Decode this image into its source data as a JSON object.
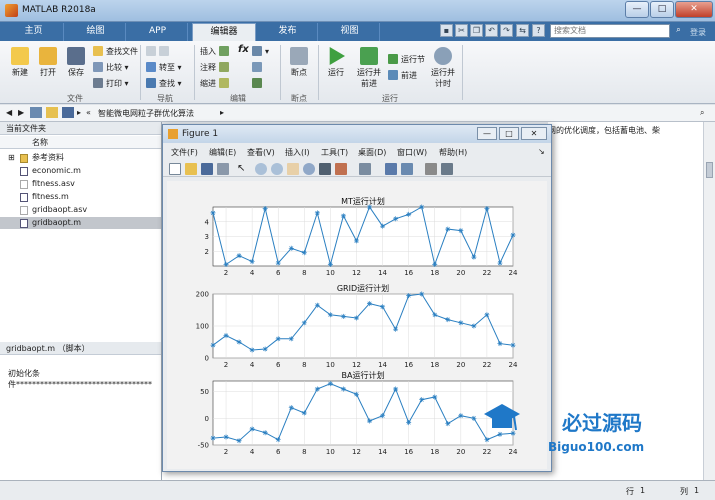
{
  "window": {
    "title": "MATLAB R2018a"
  },
  "tabs": [
    "主页",
    "绘图",
    "APP",
    "编辑器",
    "发布",
    "视图"
  ],
  "search": {
    "placeholder": "搜索文档"
  },
  "login": "登录",
  "toolstrip": {
    "file": {
      "new": "新建",
      "open": "打开",
      "save": "保存",
      "find_files": "查找文件",
      "compare": "比较",
      "print": "打印",
      "label": "文件"
    },
    "nav": {
      "goto": "转至",
      "find": "查找",
      "label": "导航"
    },
    "edit": {
      "insert": "插入",
      "comment": "注释",
      "indent": "缩进",
      "fx": "fx",
      "label": "编辑"
    },
    "breakpoint": {
      "btn": "断点",
      "label": "断点"
    },
    "run": {
      "run": "运行",
      "run_advance": "运行并\n前进",
      "run_section": "运行节",
      "advance": "前进",
      "run_time": "运行并\n计时",
      "label": "运行"
    }
  },
  "path": {
    "crumb": "智能微电网粒子群优化算法"
  },
  "current_folder": {
    "title": "当前文件夹",
    "col_name": "名称",
    "items": [
      {
        "name": "参考资料",
        "type": "folder"
      },
      {
        "name": "economic.m",
        "type": "file"
      },
      {
        "name": "fitness.asv",
        "type": "file"
      },
      {
        "name": "fitness.m",
        "type": "file"
      },
      {
        "name": "gridbaopt.asv",
        "type": "file"
      },
      {
        "name": "gridbaopt.m",
        "type": "file",
        "selected": true
      }
    ]
  },
  "detail": {
    "title": "gridbaopt.m （脚本）",
    "line1": "初始化条",
    "line2": "件**********************************"
  },
  "right_panel": {
    "text": "网的优化调度，包括蓄电池、柴"
  },
  "status": {
    "row_label": "行",
    "row": "1",
    "col_label": "列",
    "col": "1"
  },
  "figure": {
    "title": "Figure 1",
    "menu": [
      "文件(F)",
      "编辑(E)",
      "查看(V)",
      "插入(I)",
      "工具(T)",
      "桌面(D)",
      "窗口(W)",
      "帮助(H)"
    ]
  },
  "watermark": {
    "main": "必过源码",
    "sub": "Biguo100.com"
  },
  "chart_data": [
    {
      "type": "line",
      "title": "MT运行计划",
      "x": [
        1,
        2,
        3,
        4,
        5,
        6,
        7,
        8,
        9,
        10,
        11,
        12,
        13,
        14,
        15,
        16,
        17,
        18,
        19,
        20,
        21,
        22,
        23,
        24
      ],
      "values": [
        4.6,
        1.1,
        1.7,
        1.3,
        4.9,
        1.2,
        2.2,
        1.9,
        4.6,
        1.1,
        4.4,
        2.7,
        5.0,
        3.7,
        4.2,
        4.5,
        5.0,
        1.1,
        3.5,
        3.4,
        1.6,
        4.9,
        1.2,
        3.1
      ],
      "xlim": [
        1,
        24
      ],
      "ylim": [
        1,
        5
      ],
      "yticks": [
        2,
        3,
        4
      ],
      "xticks": [
        2,
        4,
        6,
        8,
        10,
        12,
        14,
        16,
        18,
        20,
        22,
        24
      ],
      "grid": true
    },
    {
      "type": "line",
      "title": "GRID运行计划",
      "x": [
        1,
        2,
        3,
        4,
        5,
        6,
        7,
        8,
        9,
        10,
        11,
        12,
        13,
        14,
        15,
        16,
        17,
        18,
        19,
        20,
        21,
        22,
        23,
        24
      ],
      "values": [
        40,
        70,
        50,
        25,
        28,
        60,
        60,
        110,
        165,
        135,
        130,
        125,
        170,
        160,
        90,
        195,
        200,
        135,
        120,
        110,
        100,
        135,
        45,
        40
      ],
      "xlim": [
        1,
        24
      ],
      "ylim": [
        0,
        200
      ],
      "yticks": [
        0,
        100,
        200
      ],
      "xticks": [
        2,
        4,
        6,
        8,
        10,
        12,
        14,
        16,
        18,
        20,
        22,
        24
      ],
      "grid": true
    },
    {
      "type": "line",
      "title": "BA运行计划",
      "x": [
        1,
        2,
        3,
        4,
        5,
        6,
        7,
        8,
        9,
        10,
        11,
        12,
        13,
        14,
        15,
        16,
        17,
        18,
        19,
        20,
        21,
        22,
        23,
        24
      ],
      "values": [
        -37,
        -35,
        -42,
        -20,
        -27,
        -40,
        20,
        10,
        55,
        65,
        55,
        45,
        -5,
        5,
        55,
        -8,
        35,
        40,
        -10,
        5,
        0,
        -40,
        -30,
        -28
      ],
      "xlim": [
        1,
        24
      ],
      "ylim": [
        -50,
        70
      ],
      "yticks": [
        -50,
        0,
        50
      ],
      "xticks": [
        2,
        4,
        6,
        8,
        10,
        12,
        14,
        16,
        18,
        20,
        22,
        24
      ],
      "grid": true
    }
  ]
}
